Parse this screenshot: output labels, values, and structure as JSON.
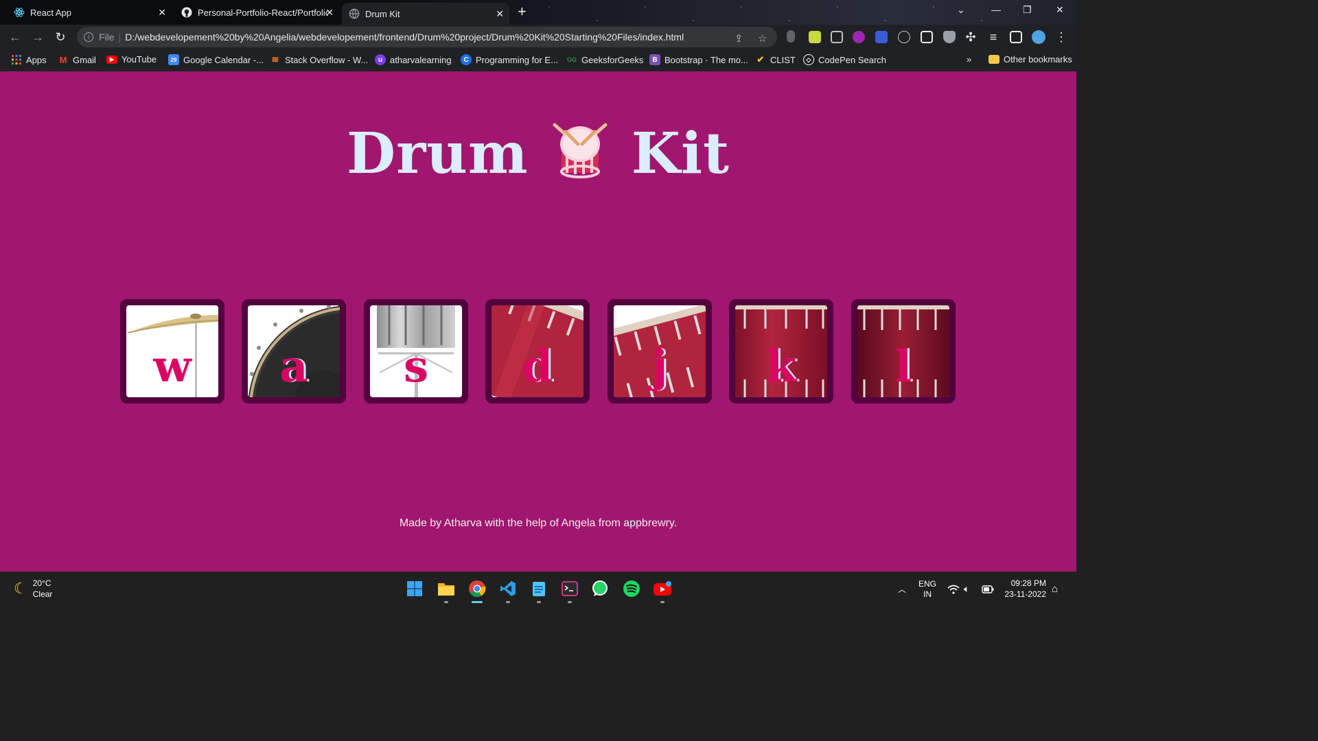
{
  "tabs": [
    {
      "title": "React App",
      "icon": "react-icon",
      "active": false
    },
    {
      "title": "Personal-Portfolio-React/Portfolio",
      "icon": "github-icon",
      "active": false
    },
    {
      "title": "Drum Kit",
      "icon": "globe-icon",
      "active": true
    }
  ],
  "address": {
    "scheme": "File",
    "url": "D:/webdevelopement%20by%20Angelia/webdevelopement/frontend/Drum%20project/Drum%20Kit%20Starting%20Files/index.html"
  },
  "bookmarks": [
    {
      "label": "Apps",
      "icon": "apps-grid-icon",
      "color": "#4285f4"
    },
    {
      "label": "Gmail",
      "icon": "gmail-icon",
      "color": "#ea4335"
    },
    {
      "label": "YouTube",
      "icon": "youtube-icon",
      "color": "#ff0000"
    },
    {
      "label": "Google Calendar -...",
      "icon": "calendar-icon",
      "color": "#4285f4"
    },
    {
      "label": "Stack Overflow - W...",
      "icon": "stackoverflow-icon",
      "color": "#f48024"
    },
    {
      "label": "atharvalearning",
      "icon": "atharvalearning-icon",
      "color": "#7b3fe4"
    },
    {
      "label": "Programming for E...",
      "icon": "programming-icon",
      "color": "#1a73e8"
    },
    {
      "label": "GeeksforGeeks",
      "icon": "geeksforgeeks-icon",
      "color": "#2f8d46"
    },
    {
      "label": "Bootstrap · The mo...",
      "icon": "bootstrap-icon",
      "color": "#7952b3"
    },
    {
      "label": "CLIST",
      "icon": "clist-icon",
      "color": "#f5c518"
    },
    {
      "label": "CodePen Search",
      "icon": "codepen-icon",
      "color": "#ffffff"
    }
  ],
  "other_bookmarks": "Other bookmarks",
  "page": {
    "title_left": "Drum",
    "title_right": "Kit",
    "drums": [
      {
        "key": "w",
        "kind": "crash"
      },
      {
        "key": "a",
        "kind": "kick"
      },
      {
        "key": "s",
        "kind": "snare"
      },
      {
        "key": "d",
        "kind": "tom1"
      },
      {
        "key": "j",
        "kind": "tom2"
      },
      {
        "key": "k",
        "kind": "tom3"
      },
      {
        "key": "l",
        "kind": "tom4"
      }
    ],
    "footer": "Made by Atharva with the help of Angela from appbrewry."
  },
  "taskbar": {
    "temperature": "20°C",
    "condition": "Clear",
    "language_top": "ENG",
    "language_bottom": "IN",
    "time": "09:28 PM",
    "date": "23-11-2022",
    "apps": [
      "windows-start-icon",
      "file-explorer-icon",
      "chrome-icon",
      "vscode-icon",
      "notepad-icon",
      "terminal-icon",
      "whatsapp-icon",
      "spotify-icon",
      "youtube-icon"
    ]
  },
  "colors": {
    "page_bg": "#a1166f",
    "title": "#dbedfd",
    "drum_border": "#53003f",
    "drum_letter": "#da0463"
  }
}
